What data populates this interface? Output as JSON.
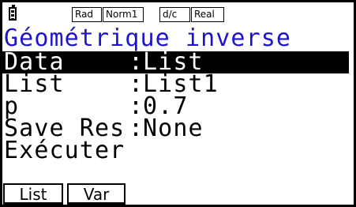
{
  "status_bar": {
    "battery_icon": "battery-icon",
    "badges": [
      "Rad",
      "Norm1",
      "d/c",
      "Real"
    ]
  },
  "title": "Géométrique inverse",
  "rows": [
    {
      "label": "Data",
      "sep": ":",
      "value": "List"
    },
    {
      "label": "List",
      "sep": ":",
      "value": "List1"
    },
    {
      "label": "p",
      "sep": ":",
      "value": "0.7"
    },
    {
      "label": "Save Res",
      "sep": ":",
      "value": "None"
    },
    {
      "label": "Exécuter",
      "sep": "",
      "value": ""
    }
  ],
  "selected_row": 0,
  "fkeys": [
    "List",
    "Var"
  ],
  "colors": {
    "title": "#1e15c8",
    "highlight_bg": "#000000",
    "highlight_fg": "#ffffff"
  }
}
